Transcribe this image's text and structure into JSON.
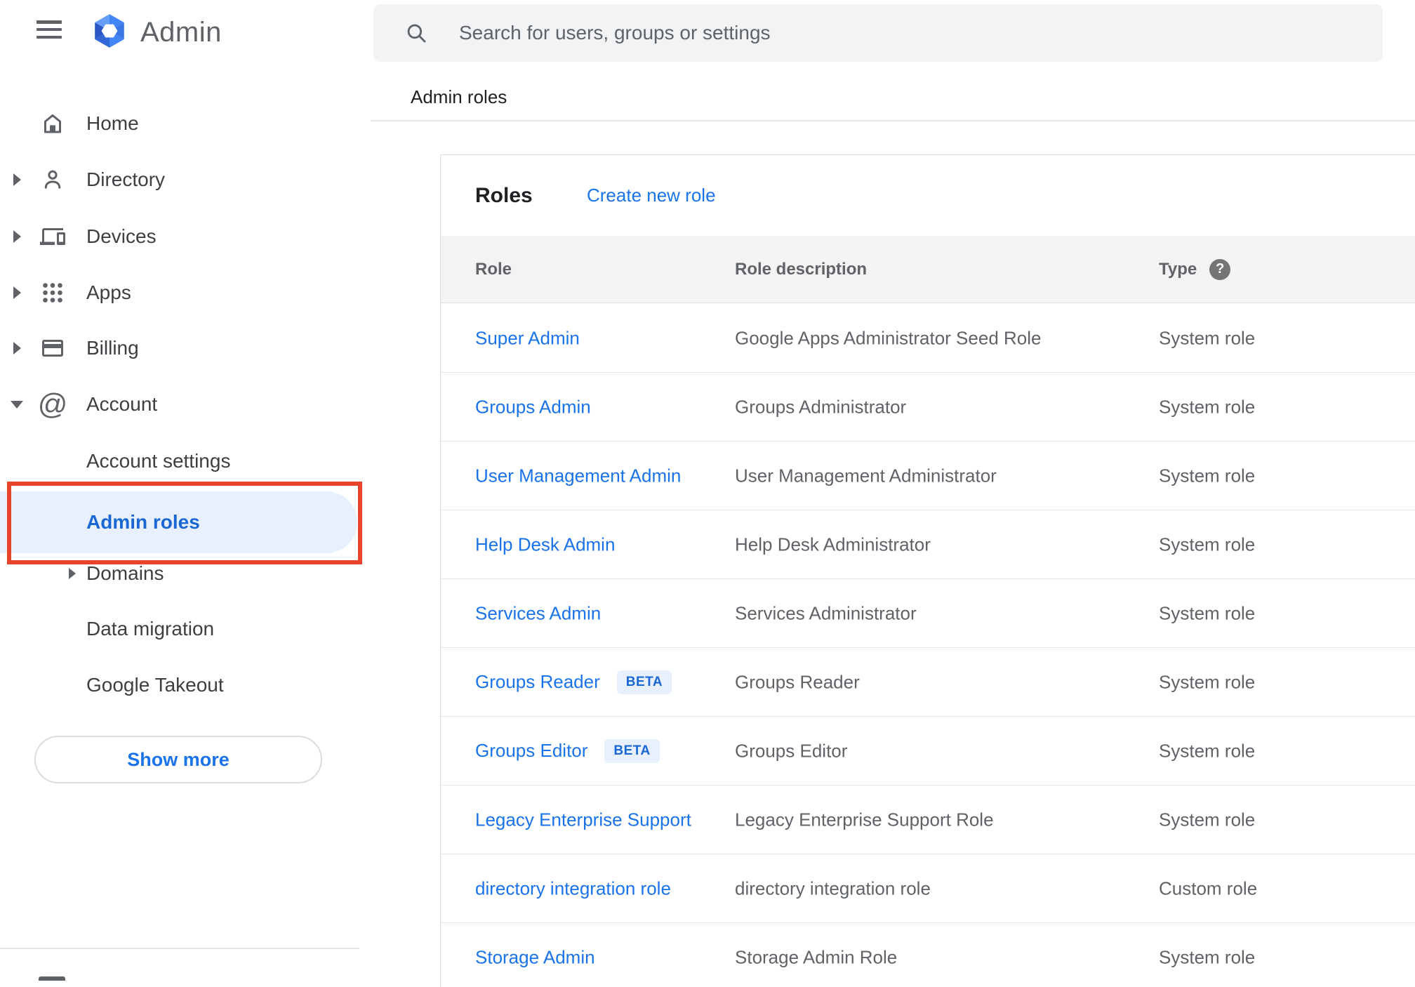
{
  "app": {
    "title": "Admin"
  },
  "search": {
    "placeholder": "Search for users, groups or settings"
  },
  "breadcrumb": "Admin roles",
  "icons": {
    "at": "@",
    "help": "?"
  },
  "sidebar": {
    "items": [
      {
        "label": "Home"
      },
      {
        "label": "Directory"
      },
      {
        "label": "Devices"
      },
      {
        "label": "Apps"
      },
      {
        "label": "Billing"
      },
      {
        "label": "Account"
      }
    ],
    "account_children": [
      {
        "label": "Account settings"
      },
      {
        "label": "Admin roles"
      },
      {
        "label": "Domains"
      },
      {
        "label": "Data migration"
      },
      {
        "label": "Google Takeout"
      }
    ],
    "show_more_label": "Show more"
  },
  "roles_card": {
    "title": "Roles",
    "create_link": "Create new role",
    "columns": {
      "role": "Role",
      "description": "Role description",
      "type": "Type"
    },
    "beta_label": "BETA",
    "rows": [
      {
        "role": "Super Admin",
        "beta": false,
        "description": "Google Apps Administrator Seed Role",
        "type": "System role"
      },
      {
        "role": "Groups Admin",
        "beta": false,
        "description": "Groups Administrator",
        "type": "System role"
      },
      {
        "role": "User Management Admin",
        "beta": false,
        "description": "User Management Administrator",
        "type": "System role"
      },
      {
        "role": "Help Desk Admin",
        "beta": false,
        "description": "Help Desk Administrator",
        "type": "System role"
      },
      {
        "role": "Services Admin",
        "beta": false,
        "description": "Services Administrator",
        "type": "System role"
      },
      {
        "role": "Groups Reader",
        "beta": true,
        "description": "Groups Reader",
        "type": "System role"
      },
      {
        "role": "Groups Editor",
        "beta": true,
        "description": "Groups Editor",
        "type": "System role"
      },
      {
        "role": "Legacy Enterprise Support",
        "beta": false,
        "description": "Legacy Enterprise Support Role",
        "type": "System role"
      },
      {
        "role": "directory integration role",
        "beta": false,
        "description": "directory integration role",
        "type": "Custom role"
      },
      {
        "role": "Storage Admin",
        "beta": false,
        "description": "Storage Admin Role",
        "type": "System role"
      }
    ]
  },
  "colors": {
    "link_blue": "#1a73e8",
    "selected_blue": "#1967d2",
    "selected_pill_bg": "#e8f0fe",
    "beta_badge_bg": "#e8f0fe",
    "annotation_red": "#e8432b",
    "icon_gray": "#5f6368",
    "table_header_bg": "#f3f3f3"
  }
}
